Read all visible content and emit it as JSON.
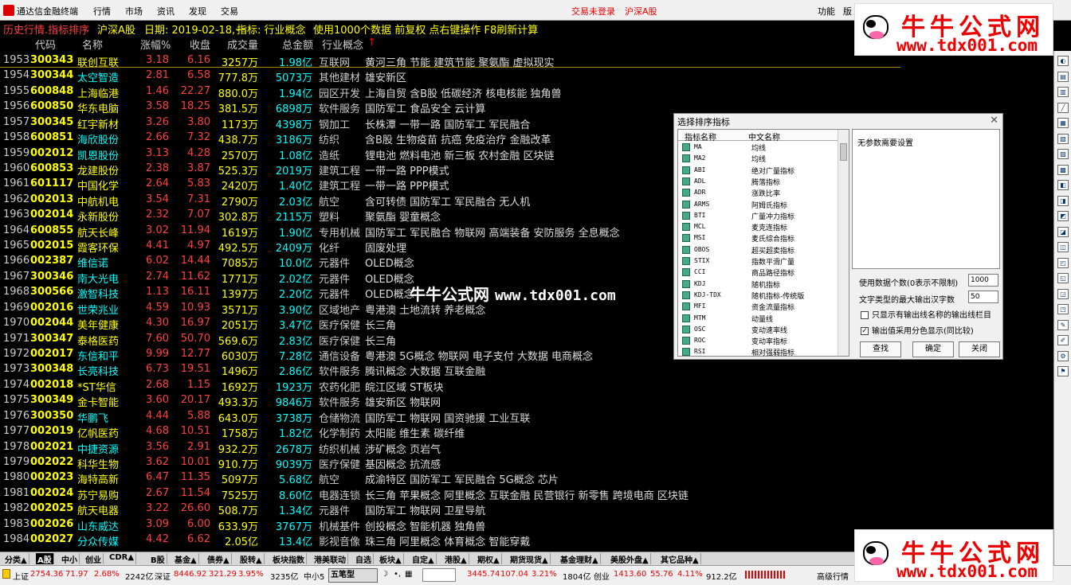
{
  "menubar": {
    "app_title": "通达信金融终端",
    "menus": [
      "行情",
      "市场",
      "资讯",
      "发现",
      "交易"
    ],
    "login": "交易未登录",
    "market": "沪深A股",
    "func": "功能",
    "version": "版"
  },
  "infoline": {
    "title": "历史行情.指标排序",
    "market": "沪深A股",
    "date_label": "日期: 2019-02-18,一",
    "indicator_label": "指标: 行业概念",
    "hint": "使用1000个数据 前复权 点右键操作 F8刷新计算"
  },
  "ad": {
    "title": "牛牛公式网",
    "url": "www.tdx001.com"
  },
  "watermark": {
    "text": "牛牛公式网",
    "url": "www.tdx001.com"
  },
  "table": {
    "headers": [
      "代码",
      "名称",
      "涨幅%",
      "收盘",
      "成交量",
      "总金额",
      "行业概念"
    ],
    "sort_arrow": "↑",
    "rows": [
      {
        "no": "1953",
        "code": "300343",
        "name": "联创互联",
        "chg": "3.18",
        "close": "6.16",
        "vol": "3257万",
        "amt": "1.98亿",
        "ind": "互联网",
        "concept": "黄河三角 节能 建筑节能 聚氨酯 虚拟现实"
      },
      {
        "no": "1954",
        "code": "300344",
        "name": "太空智造",
        "chg": "2.81",
        "close": "6.58",
        "vol": "777.8万",
        "amt": "5073万",
        "ind": "其他建材",
        "concept": "雄安新区"
      },
      {
        "no": "1955",
        "code": "600848",
        "name": "上海临港",
        "chg": "1.46",
        "close": "22.27",
        "vol": "880.0万",
        "amt": "1.94亿",
        "ind": "园区开发",
        "concept": "上海自贸 含B股 低碳经济 核电核能 独角兽"
      },
      {
        "no": "1956",
        "code": "600850",
        "name": "华东电脑",
        "chg": "3.58",
        "close": "18.25",
        "vol": "381.5万",
        "amt": "6898万",
        "ind": "软件服务",
        "concept": "国防军工 食品安全 云计算"
      },
      {
        "no": "1957",
        "code": "300345",
        "name": "红宇新材",
        "chg": "3.26",
        "close": "3.80",
        "vol": "1173万",
        "amt": "4398万",
        "ind": "钢加工",
        "concept": "长株潭 一带一路 国防军工 军民融合"
      },
      {
        "no": "1958",
        "code": "600851",
        "name": "海欣股份",
        "chg": "2.66",
        "close": "7.32",
        "vol": "438.7万",
        "amt": "3186万",
        "ind": "纺织",
        "concept": "含B股 生物疫苗 抗癌 免疫治疗 金融改革"
      },
      {
        "no": "1959",
        "code": "002012",
        "name": "凯恩股份",
        "chg": "3.13",
        "close": "4.28",
        "vol": "2570万",
        "amt": "1.08亿",
        "ind": "造纸",
        "concept": "锂电池 燃料电池 新三板 农村金融 区块链"
      },
      {
        "no": "1960",
        "code": "600853",
        "name": "龙建股份",
        "chg": "2.38",
        "close": "3.87",
        "vol": "525.3万",
        "amt": "2019万",
        "ind": "建筑工程",
        "concept": "一带一路 PPP模式"
      },
      {
        "no": "1961",
        "code": "601117",
        "name": "中国化学",
        "chg": "2.64",
        "close": "5.83",
        "vol": "2420万",
        "amt": "1.40亿",
        "ind": "建筑工程",
        "concept": "一带一路 PPP模式"
      },
      {
        "no": "1962",
        "code": "002013",
        "name": "中航机电",
        "chg": "3.54",
        "close": "7.31",
        "vol": "2790万",
        "amt": "2.03亿",
        "ind": "航空",
        "concept": "含可转债 国防军工 军民融合 无人机"
      },
      {
        "no": "1963",
        "code": "002014",
        "name": "永新股份",
        "chg": "2.32",
        "close": "7.07",
        "vol": "302.8万",
        "amt": "2115万",
        "ind": "塑料",
        "concept": "聚氨酯 婴童概念"
      },
      {
        "no": "1964",
        "code": "600855",
        "name": "航天长峰",
        "chg": "3.02",
        "close": "11.94",
        "vol": "1619万",
        "amt": "1.90亿",
        "ind": "专用机械",
        "concept": "国防军工 军民融合 物联网 高端装备 安防服务 全息概念"
      },
      {
        "no": "1965",
        "code": "002015",
        "name": "霞客环保",
        "chg": "4.41",
        "close": "4.97",
        "vol": "492.5万",
        "amt": "2409万",
        "ind": "化纤",
        "concept": "固废处理"
      },
      {
        "no": "1966",
        "code": "002387",
        "name": "维信诺",
        "chg": "6.02",
        "close": "14.44",
        "vol": "7085万",
        "amt": "10.0亿",
        "ind": "元器件",
        "concept": "OLED概念"
      },
      {
        "no": "1967",
        "code": "300346",
        "name": "南大光电",
        "chg": "2.74",
        "close": "11.62",
        "vol": "1771万",
        "amt": "2.02亿",
        "ind": "元器件",
        "concept": "OLED概念"
      },
      {
        "no": "1968",
        "code": "300566",
        "name": "激智科技",
        "chg": "1.13",
        "close": "16.11",
        "vol": "1397万",
        "amt": "2.20亿",
        "ind": "元器件",
        "concept": "OLED概念"
      },
      {
        "no": "1969",
        "code": "002016",
        "name": "世荣兆业",
        "chg": "4.59",
        "close": "10.93",
        "vol": "3571万",
        "amt": "3.90亿",
        "ind": "区域地产",
        "concept": "粤港澳 土地流转 养老概念"
      },
      {
        "no": "1970",
        "code": "002044",
        "name": "美年健康",
        "chg": "4.30",
        "close": "16.97",
        "vol": "2051万",
        "amt": "3.47亿",
        "ind": "医疗保健",
        "concept": "长三角"
      },
      {
        "no": "1971",
        "code": "300347",
        "name": "泰格医药",
        "chg": "7.60",
        "close": "50.70",
        "vol": "569.6万",
        "amt": "2.83亿",
        "ind": "医疗保健",
        "concept": "长三角"
      },
      {
        "no": "1972",
        "code": "002017",
        "name": "东信和平",
        "chg": "9.99",
        "close": "12.77",
        "vol": "6030万",
        "amt": "7.28亿",
        "ind": "通信设备",
        "concept": "粤港澳 5G概念 物联网 电子支付 大数据 电商概念"
      },
      {
        "no": "1973",
        "code": "300348",
        "name": "长亮科技",
        "chg": "6.73",
        "close": "19.51",
        "vol": "1496万",
        "amt": "2.86亿",
        "ind": "软件服务",
        "concept": "腾讯概念 大数据 互联金融"
      },
      {
        "no": "1974",
        "code": "002018",
        "name": "*ST华信",
        "chg": "2.68",
        "close": "1.15",
        "vol": "1692万",
        "amt": "1923万",
        "ind": "农药化肥",
        "concept": "皖江区域 ST板块"
      },
      {
        "no": "1975",
        "code": "300349",
        "name": "金卡智能",
        "chg": "3.60",
        "close": "20.17",
        "vol": "493.3万",
        "amt": "9846万",
        "ind": "软件服务",
        "concept": "雄安新区 物联网"
      },
      {
        "no": "1976",
        "code": "300350",
        "name": "华鹏飞",
        "chg": "4.44",
        "close": "5.88",
        "vol": "643.0万",
        "amt": "3738万",
        "ind": "仓储物流",
        "concept": "国防军工 物联网 国资驰援 工业互联"
      },
      {
        "no": "1977",
        "code": "002019",
        "name": "亿帆医药",
        "chg": "4.68",
        "close": "10.51",
        "vol": "1758万",
        "amt": "1.82亿",
        "ind": "化学制药",
        "concept": "太阳能 维生素 碳纤维"
      },
      {
        "no": "1978",
        "code": "002021",
        "name": "中捷资源",
        "chg": "3.56",
        "close": "2.91",
        "vol": "932.2万",
        "amt": "2678万",
        "ind": "纺织机械",
        "concept": "涉矿概念 页岩气"
      },
      {
        "no": "1979",
        "code": "002022",
        "name": "科华生物",
        "chg": "3.62",
        "close": "10.01",
        "vol": "910.7万",
        "amt": "9039万",
        "ind": "医疗保健",
        "concept": "基因概念 抗流感"
      },
      {
        "no": "1980",
        "code": "002023",
        "name": "海特高新",
        "chg": "6.47",
        "close": "11.35",
        "vol": "5097万",
        "amt": "5.68亿",
        "ind": "航空",
        "concept": "成渝特区 国防军工 军民融合 5G概念 芯片"
      },
      {
        "no": "1981",
        "code": "002024",
        "name": "苏宁易购",
        "chg": "2.67",
        "close": "11.54",
        "vol": "7525万",
        "amt": "8.60亿",
        "ind": "电器连锁",
        "concept": "长三角 苹果概念 阿里概念 互联金融 民营银行 新零售 跨境电商 区块链"
      },
      {
        "no": "1982",
        "code": "002025",
        "name": "航天电器",
        "chg": "3.22",
        "close": "26.60",
        "vol": "508.7万",
        "amt": "1.34亿",
        "ind": "元器件",
        "concept": "国防军工 物联网 卫星导航"
      },
      {
        "no": "1983",
        "code": "002026",
        "name": "山东威达",
        "chg": "3.09",
        "close": "6.00",
        "vol": "633.9万",
        "amt": "3767万",
        "ind": "机械基件",
        "concept": "创投概念 智能机器 独角兽"
      },
      {
        "no": "1984",
        "code": "002027",
        "name": "分众传媒",
        "chg": "4.42",
        "close": "6.62",
        "vol": "2.05亿",
        "amt": "13.4亿",
        "ind": "影视音像",
        "concept": "珠三角 阿里概念 体育概念 智能穿戴"
      }
    ]
  },
  "dialog": {
    "title": "选择排序指标",
    "col_en": "指标名称",
    "col_cn": "中文名称",
    "indicators": [
      {
        "en": "MA",
        "cn": "均线"
      },
      {
        "en": "MA2",
        "cn": "均线"
      },
      {
        "en": "ABI",
        "cn": "绝对广量指标"
      },
      {
        "en": "ADL",
        "cn": "腾落指标"
      },
      {
        "en": "ADR",
        "cn": "涨跌比率"
      },
      {
        "en": "ARMS",
        "cn": "阿姆氏指标"
      },
      {
        "en": "BTI",
        "cn": "广量冲力指标"
      },
      {
        "en": "MCL",
        "cn": "麦克连指标"
      },
      {
        "en": "MSI",
        "cn": "麦氏综合指标"
      },
      {
        "en": "OBOS",
        "cn": "超买超卖指标"
      },
      {
        "en": "STIX",
        "cn": "指数平滑广量"
      },
      {
        "en": "CCI",
        "cn": "商品路径指标"
      },
      {
        "en": "KDJ",
        "cn": "随机指标"
      },
      {
        "en": "KDJ-TDX",
        "cn": "随机指标-传统版"
      },
      {
        "en": "MFI",
        "cn": "资金流量指标"
      },
      {
        "en": "MTM",
        "cn": "动量线"
      },
      {
        "en": "OSC",
        "cn": "变动速率线"
      },
      {
        "en": "ROC",
        "cn": "变动率指标"
      },
      {
        "en": "RSI",
        "cn": "相对强弱指标"
      }
    ],
    "param_text": "无参数需要设置",
    "use_data_label": "使用数据个数(0表示不限制)",
    "use_data_value": "1000",
    "max_chars_label": "文字类型的最大输出汉字数",
    "max_chars_value": "50",
    "chk1": "只显示有输出线名称的输出线栏目",
    "chk2": "输出值采用分色显示(同比较)",
    "btn_find": "查找",
    "btn_ok": "确定",
    "btn_close": "关闭"
  },
  "tabbar": {
    "tabs": [
      "分类▲",
      "A股",
      "中小",
      "创业",
      "CDR▲",
      "B股",
      "基金▲",
      "债券▲",
      "股转▲",
      "板块指数",
      "港美联动",
      "自选",
      "板块▲",
      "自定▲",
      "港股▲",
      "期权▲",
      "期货现货▲",
      "基金理财▲",
      "美股外盘▲",
      "其它品种▲"
    ],
    "active": 1
  },
  "status": {
    "sh_label": "上证",
    "sh_value": "2754.36",
    "sh_chg": "71.97",
    "sh_pct": "2.68%",
    "sh_amt": "2242亿",
    "sz_label": "深证",
    "sz_value": "8446.92",
    "sz_chg": "321.29",
    "sz_pct": "3.95%",
    "sz_amt": "3235亿",
    "zx_label": "中小5",
    "wubi": "五笔型",
    "mid_value": "3445.74",
    "mid_chg": "107.04",
    "mid_pct": "3.21%",
    "mid_amt": "1804亿",
    "cy_label": "创业",
    "cy_value": "1413.60",
    "cy_chg": "55.76",
    "cy_pct": "4.11%",
    "cy_amt": "912.2亿",
    "adv": "高级行情"
  }
}
